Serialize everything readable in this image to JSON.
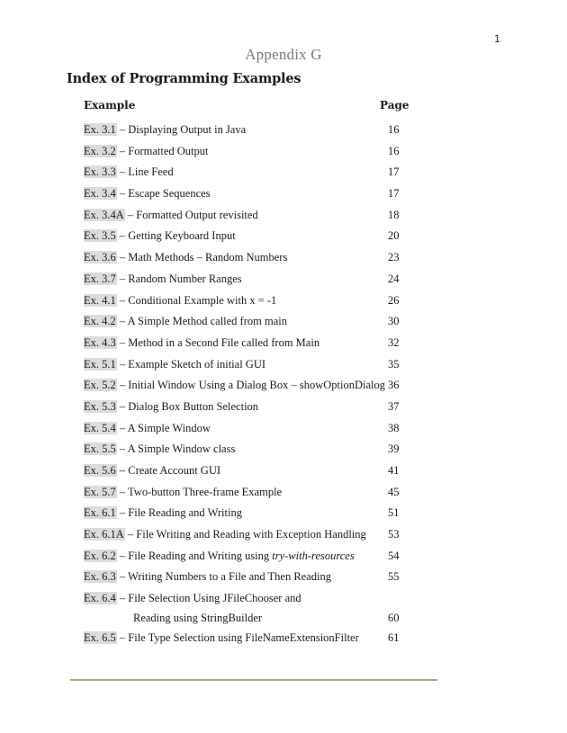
{
  "page_number": "1",
  "appendix_title": "Appendix G",
  "heading": "Index of Programming Examples",
  "columns": {
    "example": "Example",
    "page": "Page"
  },
  "entries": [
    {
      "id": "Ex. 3.1",
      "title": " – Displaying Output in Java",
      "page": "16"
    },
    {
      "id": "Ex. 3.2",
      "title": " – Formatted Output",
      "page": "16"
    },
    {
      "id": "Ex. 3.3",
      "title": " – Line Feed",
      "page": "17"
    },
    {
      "id": "Ex. 3.4",
      "title": " – Escape Sequences",
      "page": "17"
    },
    {
      "id": "Ex. 3.4A",
      "title": " – Formatted Output revisited",
      "page": "18"
    },
    {
      "id": "Ex. 3.5",
      "title": " – Getting Keyboard Input",
      "page": "20"
    },
    {
      "id": "Ex. 3.6",
      "title": " – Math Methods – Random Numbers",
      "page": "23"
    },
    {
      "id": "Ex. 3.7",
      "title": " – Random Number Ranges",
      "page": "24"
    },
    {
      "id": "Ex. 4.1",
      "title": " – Conditional Example with x = -1",
      "page": "26"
    },
    {
      "id": "Ex. 4.2",
      "title": " – A Simple Method called from main",
      "page": "30"
    },
    {
      "id": "Ex. 4.3",
      "title": " – Method in a Second File called from Main",
      "page": "32"
    },
    {
      "id": "Ex. 5.1",
      "title": " – Example Sketch of initial GUI",
      "page": "35"
    },
    {
      "id": "Ex. 5.2",
      "title": " – Initial Window Using a Dialog Box – showOptionDialog",
      "page": "36"
    },
    {
      "id": "Ex. 5.3",
      "title": " – Dialog Box Button Selection",
      "page": "37"
    },
    {
      "id": "Ex. 5.4",
      "title": " – A Simple Window",
      "page": "38"
    },
    {
      "id": "Ex. 5.5",
      "title": " – A Simple Window class",
      "page": "39"
    },
    {
      "id": "Ex. 5.6",
      "title": " – Create Account GUI",
      "page": "41"
    },
    {
      "id": "Ex. 5.7",
      "title": " – Two-button Three-frame Example",
      "page": "45"
    },
    {
      "id": "Ex. 6.1",
      "title": " – File Reading and Writing",
      "page": "51"
    },
    {
      "id": "Ex. 6.1A",
      "title": " – File Writing and Reading with Exception Handling",
      "page": "53"
    },
    {
      "id": "Ex. 6.2",
      "title": " – File Reading and Writing using ",
      "italic": "try-with-resources",
      "page": "54"
    },
    {
      "id": "Ex. 6.3",
      "title": " – Writing Numbers to a File and Then Reading",
      "page": "55"
    },
    {
      "id": "Ex. 6.4",
      "title": " – File Selection Using JFileChooser and",
      "continuation": "Reading using StringBuilder",
      "page": "60"
    },
    {
      "id": "Ex. 6.5",
      "title": " – File Type Selection using FileNameExtensionFilter",
      "page": "61"
    }
  ],
  "footer_rule_color": "#9aae7a"
}
